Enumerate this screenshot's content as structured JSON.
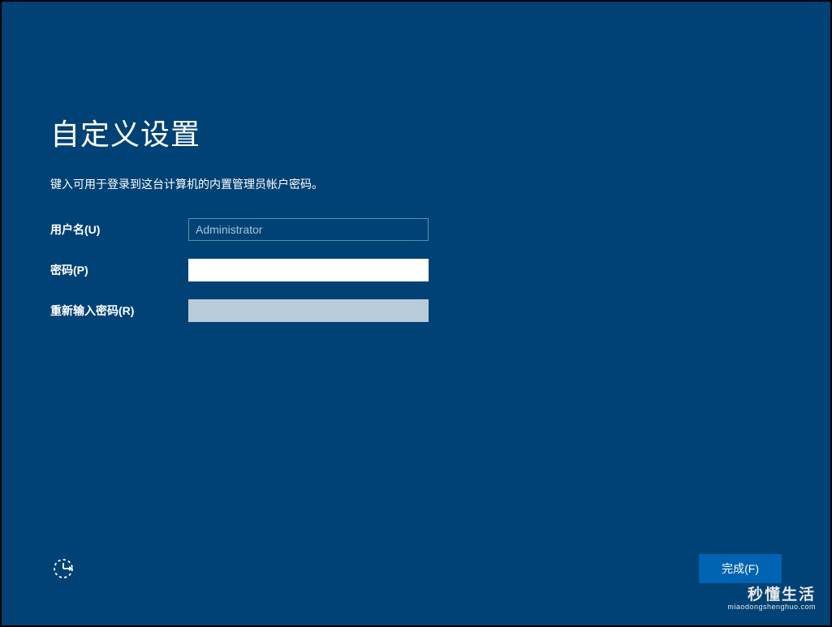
{
  "title": "自定义设置",
  "description": "键入可用于登录到这台计算机的内置管理员帐户密码。",
  "form": {
    "username_label": "用户名(U)",
    "username_value": "Administrator",
    "password_label": "密码(P)",
    "password_value": "",
    "confirm_label": "重新输入密码(R)",
    "confirm_value": ""
  },
  "buttons": {
    "finish": "完成(F)"
  },
  "watermark": {
    "title": "秒懂生活",
    "url": "miaodongshenghuo.com"
  }
}
